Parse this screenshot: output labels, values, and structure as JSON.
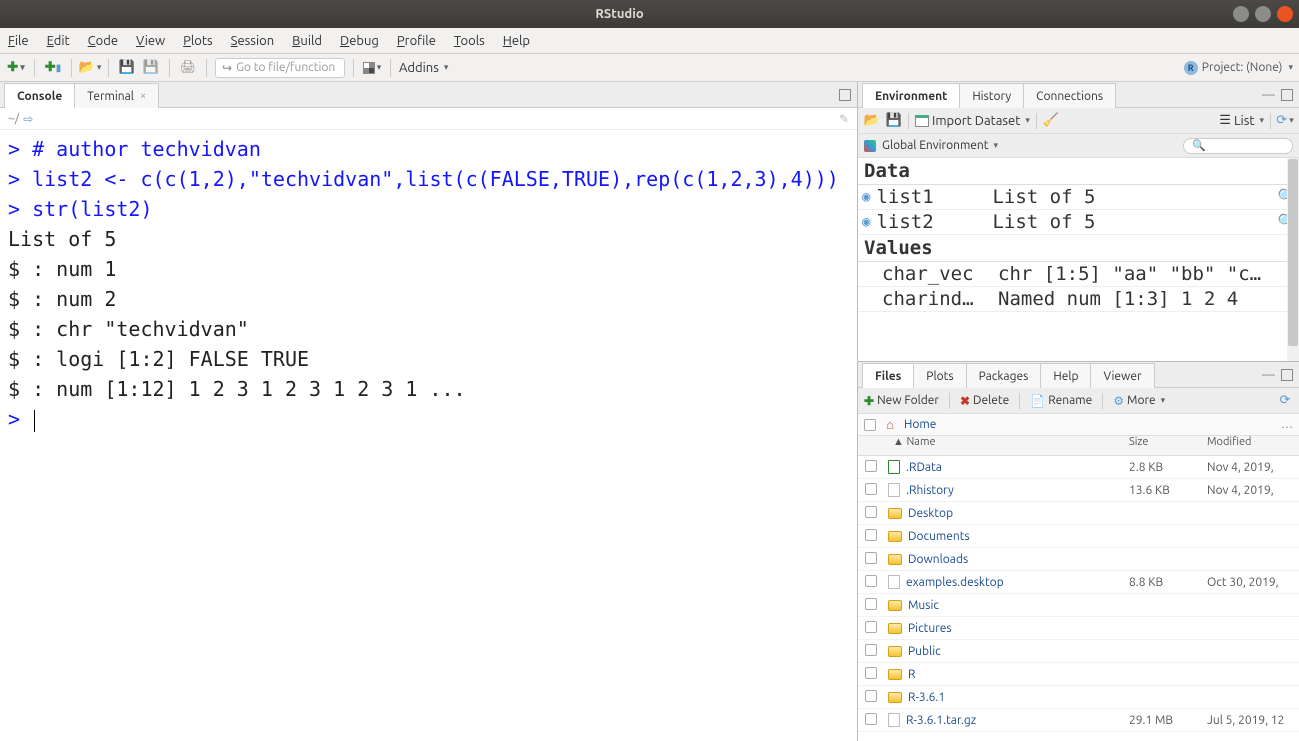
{
  "window": {
    "title": "RStudio"
  },
  "menubar": [
    "File",
    "Edit",
    "Code",
    "View",
    "Plots",
    "Session",
    "Build",
    "Debug",
    "Profile",
    "Tools",
    "Help"
  ],
  "toolbar": {
    "goto_placeholder": "Go to file/function",
    "addins": "Addins",
    "project_label": "Project: (None)"
  },
  "left_tabs": {
    "console": "Console",
    "terminal": "Terminal"
  },
  "console_path": "~/",
  "console_lines": [
    {
      "type": "prompt",
      "text": "# author techvidvan"
    },
    {
      "type": "prompt",
      "text": "list2 <- c(c(1,2),\"techvidvan\",list(c(FALSE,TRUE),rep(c(1,2,3),4)))"
    },
    {
      "type": "prompt",
      "text": "str(list2)"
    },
    {
      "type": "out",
      "text": "List of 5"
    },
    {
      "type": "out",
      "text": " $ : num 1"
    },
    {
      "type": "out",
      "text": " $ : num 2"
    },
    {
      "type": "out",
      "text": " $ : chr \"techvidvan\""
    },
    {
      "type": "out",
      "text": " $ : logi [1:2] FALSE TRUE"
    },
    {
      "type": "out",
      "text": " $ : num [1:12] 1 2 3 1 2 3 1 2 3 1 ..."
    }
  ],
  "env_tabs": [
    "Environment",
    "History",
    "Connections"
  ],
  "env_toolbar": {
    "import": "Import Dataset",
    "view_mode": "List",
    "scope": "Global Environment"
  },
  "env_data": {
    "data_header": "Data",
    "values_header": "Values",
    "data_rows": [
      {
        "name": "list1",
        "val": "List of 5"
      },
      {
        "name": "list2",
        "val": "List of 5"
      }
    ],
    "value_rows": [
      {
        "name": "char_vec",
        "val": "chr [1:5] \"aa\" \"bb\" \"c…"
      },
      {
        "name": "charind…",
        "val": "Named num [1:3] 1 2 4"
      }
    ]
  },
  "files_tabs": [
    "Files",
    "Plots",
    "Packages",
    "Help",
    "Viewer"
  ],
  "files_toolbar": {
    "new_folder": "New Folder",
    "delete": "Delete",
    "rename": "Rename",
    "more": "More"
  },
  "files_path": "Home",
  "files_cols": {
    "name": "Name",
    "size": "Size",
    "modified": "Modified"
  },
  "files": [
    {
      "icon": "rdata",
      "name": ".RData",
      "size": "2.8 KB",
      "modified": "Nov 4, 2019,"
    },
    {
      "icon": "file",
      "name": ".Rhistory",
      "size": "13.6 KB",
      "modified": "Nov 4, 2019,"
    },
    {
      "icon": "folder",
      "name": "Desktop",
      "size": "",
      "modified": ""
    },
    {
      "icon": "folder",
      "name": "Documents",
      "size": "",
      "modified": ""
    },
    {
      "icon": "folder",
      "name": "Downloads",
      "size": "",
      "modified": ""
    },
    {
      "icon": "file",
      "name": "examples.desktop",
      "size": "8.8 KB",
      "modified": "Oct 30, 2019,"
    },
    {
      "icon": "folder",
      "name": "Music",
      "size": "",
      "modified": ""
    },
    {
      "icon": "folder",
      "name": "Pictures",
      "size": "",
      "modified": ""
    },
    {
      "icon": "folder",
      "name": "Public",
      "size": "",
      "modified": ""
    },
    {
      "icon": "folder",
      "name": "R",
      "size": "",
      "modified": ""
    },
    {
      "icon": "folder",
      "name": "R-3.6.1",
      "size": "",
      "modified": ""
    },
    {
      "icon": "file",
      "name": "R-3.6.1.tar.gz",
      "size": "29.1 MB",
      "modified": "Jul 5, 2019, 12"
    }
  ]
}
